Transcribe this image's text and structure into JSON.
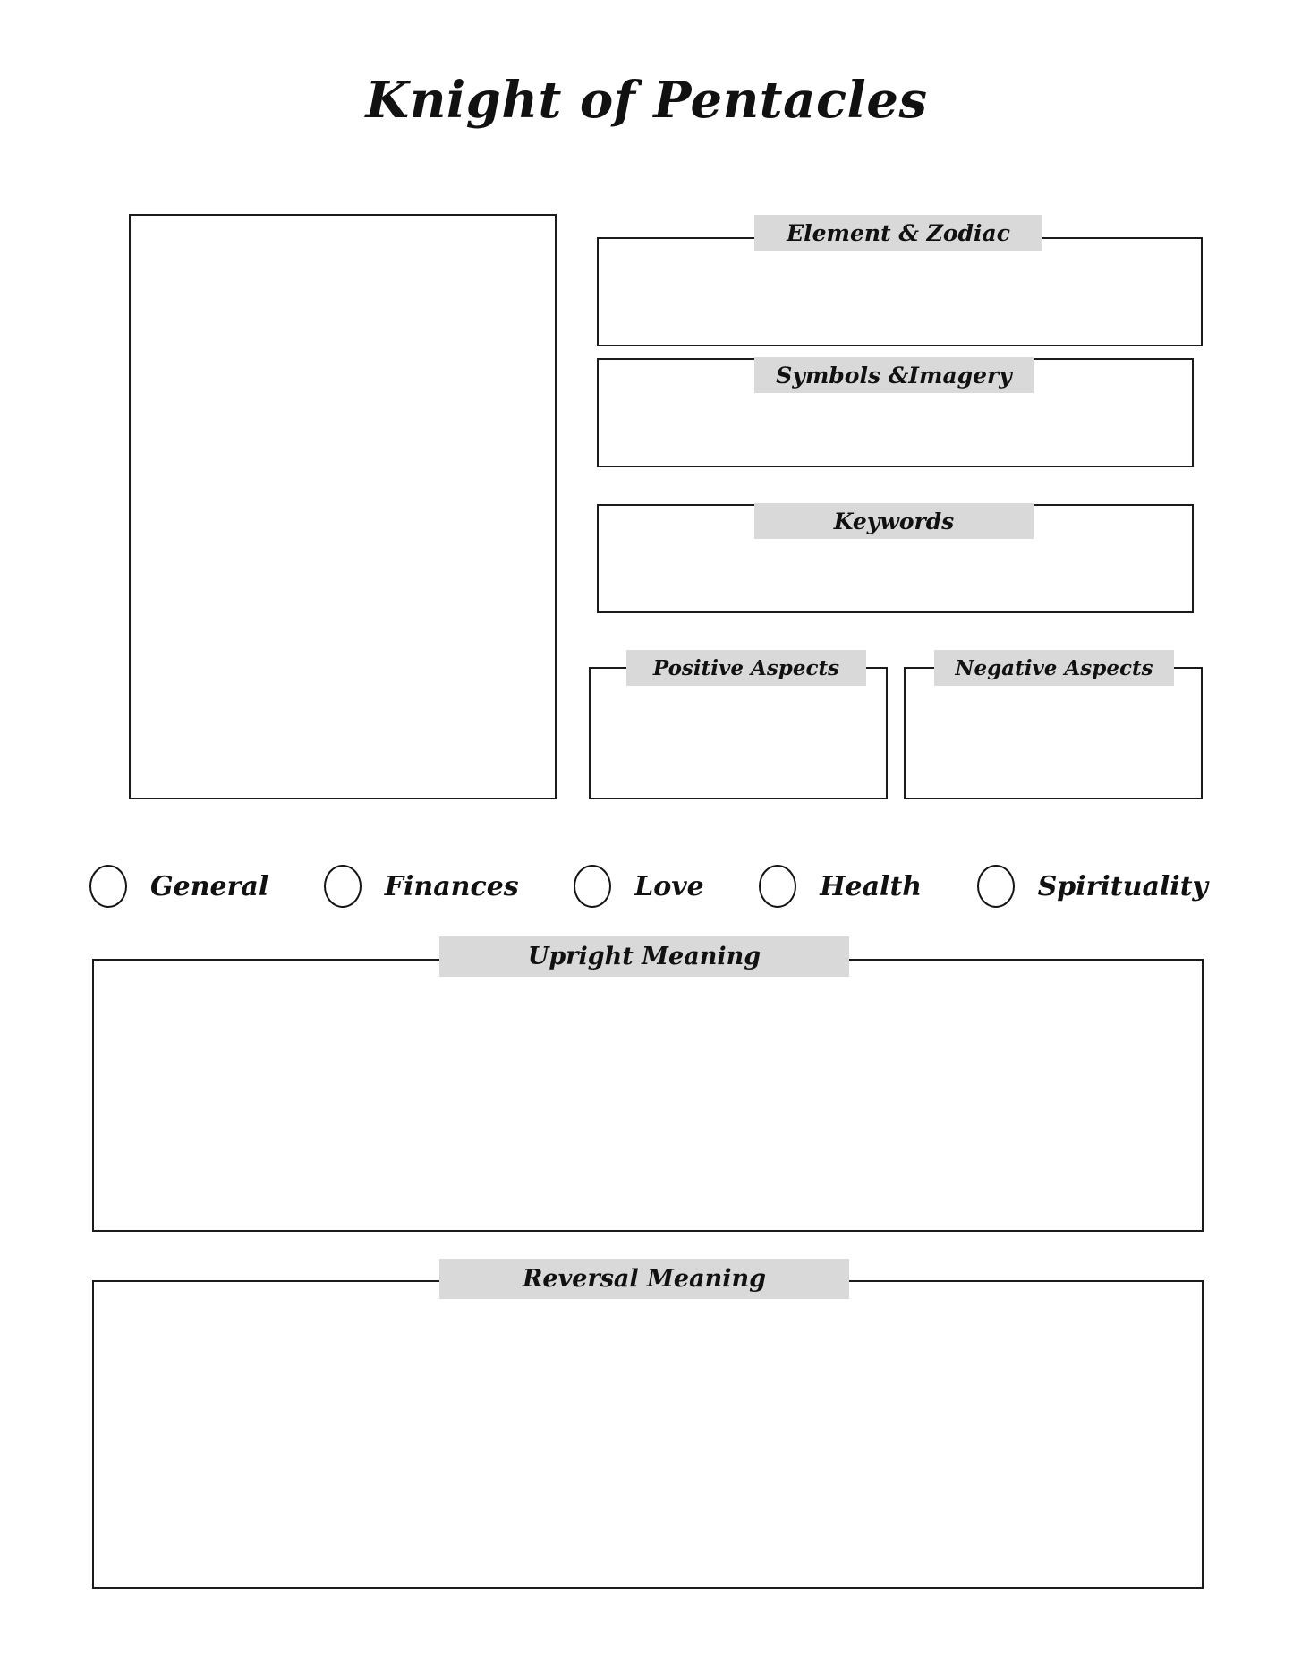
{
  "title": "Knight of Pentacles",
  "card_image": {
    "name": "card-image-placeholder",
    "value": ""
  },
  "sections": {
    "element_zodiac": {
      "label": "Element & Zodiac",
      "value": ""
    },
    "symbols_imagery": {
      "label": "Symbols &Imagery",
      "value": ""
    },
    "keywords": {
      "label": "Keywords",
      "value": ""
    },
    "positive_aspects": {
      "label": "Positive Aspects",
      "value": ""
    },
    "negative_aspects": {
      "label": "Negative Aspects",
      "value": ""
    },
    "upright_meaning": {
      "label": "Upright Meaning",
      "value": ""
    },
    "reversal_meaning": {
      "label": "Reversal Meaning",
      "value": ""
    }
  },
  "categories": [
    {
      "label": "General",
      "selected": false
    },
    {
      "label": "Finances",
      "selected": false
    },
    {
      "label": "Love",
      "selected": false
    },
    {
      "label": "Health",
      "selected": false
    },
    {
      "label": "Spirituality",
      "selected": false
    }
  ],
  "colors": {
    "caption_band": "#d9d9d9",
    "border": "#1b1b1b",
    "text": "#111111",
    "background": "#ffffff"
  }
}
